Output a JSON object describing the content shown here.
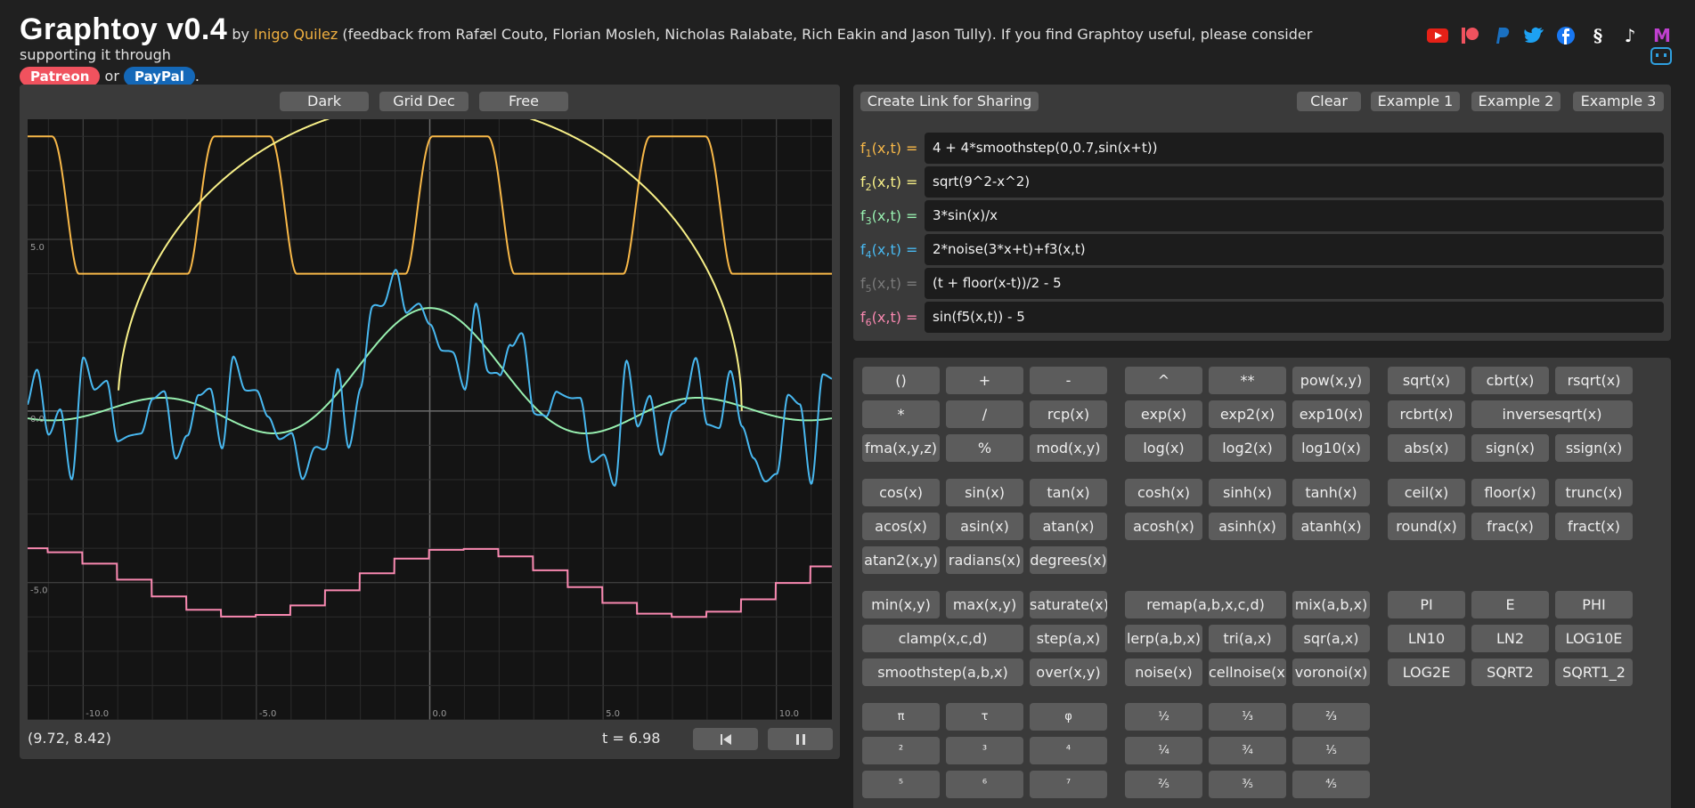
{
  "header": {
    "title": "Graphtoy v0.4",
    "by": " by ",
    "author": "Inigo Quilez",
    "credits": " (feedback from Rafæl Couto, Florian Mosleh, Nicholas Ralabate, Rich Eakin and Jason Tully). If you find Graphtoy useful, please consider supporting it through",
    "patreon": "Patreon",
    "or": " or ",
    "paypal": "PayPal",
    "period": "."
  },
  "socials": [
    {
      "icon": "youtube-icon",
      "color": "#e62117"
    },
    {
      "icon": "patreon-icon",
      "color": "#f0525e"
    },
    {
      "icon": "paypal-icon",
      "color": "#1a70c0"
    },
    {
      "icon": "twitter-icon",
      "color": "#1da1f2"
    },
    {
      "icon": "facebook-icon",
      "color": "#1877f2"
    },
    {
      "icon": "threads-icon",
      "color": "#ffffff"
    },
    {
      "icon": "tiktok-icon",
      "color": "#ffffff"
    },
    {
      "icon": "mastodon-icon",
      "color": "#c040d0",
      "glyph": "M"
    },
    {
      "icon": "bilibili-icon",
      "color": "#2fa0e0"
    }
  ],
  "graph_toolbar": {
    "theme": "Dark",
    "grid": "Grid Dec",
    "mode": "Free"
  },
  "graph_status": {
    "coords": "(9.72, 8.42)",
    "time": "t = 6.98"
  },
  "axis_labels": {
    "x": [
      "-10.0",
      "-5.0",
      "0.0",
      "5.0",
      "10.0"
    ],
    "y": [
      "5.0",
      "0.0",
      "-5.0"
    ]
  },
  "functions_toolbar": {
    "share": "Create Link for Sharing",
    "clear": "Clear",
    "ex1": "Example 1",
    "ex2": "Example 2",
    "ex3": "Example 3"
  },
  "functions": [
    {
      "name": "f",
      "sub": "1",
      "args": "(x,t)",
      "eq": " =",
      "expr": "4 + 4*smoothstep(0,0.7,sin(x+t))",
      "color": "#f8b848"
    },
    {
      "name": "f",
      "sub": "2",
      "args": "(x,t)",
      "eq": " =",
      "expr": "sqrt(9^2-x^2)",
      "color": "#f8f088"
    },
    {
      "name": "f",
      "sub": "3",
      "args": "(x,t)",
      "eq": " =",
      "expr": "3*sin(x)/x",
      "color": "#98f0b0"
    },
    {
      "name": "f",
      "sub": "4",
      "args": "(x,t)",
      "eq": " =",
      "expr": "2*noise(3*x+t)+f3(x,t)",
      "color": "#48b8f0"
    },
    {
      "name": "f",
      "sub": "5",
      "args": "(x,t)",
      "eq": " =",
      "expr": "(t + floor(x-t))/2 - 5",
      "color": "#7a7a7a"
    },
    {
      "name": "f",
      "sub": "6",
      "args": "(x,t)",
      "eq": " =",
      "expr": "sin(f5(x,t)) - 5",
      "color": "#f888b0"
    }
  ],
  "keypad": [
    "()",
    "+",
    "-",
    "^",
    "**",
    "pow(x,y)",
    "sqrt(x)",
    "cbrt(x)",
    "rsqrt(x)",
    "*",
    "/",
    "rcp(x)",
    "exp(x)",
    "exp2(x)",
    "exp10(x)",
    "rcbrt(x)",
    "inversesqrt(x)",
    "fma(x,y,z)",
    "%",
    "mod(x,y)",
    "log(x)",
    "log2(x)",
    "log10(x)",
    "abs(x)",
    "sign(x)",
    "ssign(x)",
    "cos(x)",
    "sin(x)",
    "tan(x)",
    "cosh(x)",
    "sinh(x)",
    "tanh(x)",
    "ceil(x)",
    "floor(x)",
    "trunc(x)",
    "acos(x)",
    "asin(x)",
    "atan(x)",
    "acosh(x)",
    "asinh(x)",
    "atanh(x)",
    "round(x)",
    "frac(x)",
    "fract(x)",
    "atan2(x,y)",
    "radians(x)",
    "degrees(x)",
    "min(x,y)",
    "max(x,y)",
    "saturate(x)",
    "remap(a,b,x,c,d)",
    "mix(a,b,x)",
    "PI",
    "E",
    "PHI",
    "clamp(x,c,d)",
    "step(a,x)",
    "lerp(a,b,x)",
    "tri(a,x)",
    "sqr(a,x)",
    "LN10",
    "LN2",
    "LOG10E",
    "smoothstep(a,b,x)",
    "over(x,y)",
    "noise(x)",
    "cellnoise(x)",
    "voronoi(x)",
    "LOG2E",
    "SQRT2",
    "SQRT1_2",
    "π",
    "τ",
    "φ",
    "½",
    "⅓",
    "⅔",
    "²",
    "³",
    "⁴",
    "¼",
    "¾",
    "⅕",
    "⁵",
    "⁶",
    "⁷",
    "⅖",
    "⅗",
    "⅘"
  ],
  "colors": {
    "background": "#202020",
    "panel": "#3a3a3a",
    "button": "#5c5c5c",
    "graph_bg": "#141414"
  }
}
